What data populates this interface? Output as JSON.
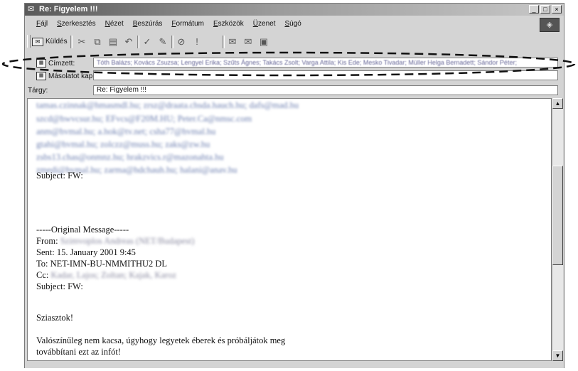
{
  "window": {
    "title": "Re: Figyelem !!!",
    "controls": [
      "_",
      "□",
      "×"
    ]
  },
  "menu": [
    "Fájl",
    "Szerkesztés",
    "Nézet",
    "Beszúrás",
    "Formátum",
    "Eszközök",
    "Üzenet",
    "Súgó"
  ],
  "toolbar": {
    "send_label": "Küldés",
    "icons": [
      "cut-icon",
      "copy-icon",
      "paste-icon",
      "undo-icon",
      "check-names-icon",
      "spelling-icon",
      "attach-icon",
      "priority-icon",
      "sign-icon",
      "encrypt-icon",
      "offline-icon"
    ]
  },
  "headers": {
    "to_label": "Címzett:",
    "to_value": "Tóth Balázs; Kovács Zsuzsa; Lengyel Erika; Szűts Ágnes; Takács Zsolt; Varga Attila; Kis Ede; Mesko Tivadar; Müller Helga Bernadett; Sándor Péter;",
    "cc_label": "Másolatot kap:",
    "cc_value": "",
    "subject_label": "Tárgy:",
    "subject_value": "Re: Figyelem !!!"
  },
  "body": {
    "blurred_lines": [
      "tamas.czinnak@hmasmdl.hu; zrsz@draata.chsda.hauch.hu; dafs@mad.hu",
      "szcd@hwvcsur.hu; EFvcs@F20M.HU; Peter.Ca@nmsc.com",
      "anm@hvmal.hu; a.hok@tv.net; csha77@hvmal.hu",
      "gtahi@hvmal.hu; zolczz@muss.hu; zaks@zw.hu",
      "zsbs13.chas@onmnz.hu; hrakzvics.r@mazonahta.hu",
      "zmedi@hvmal.hu; zarma@hdchauh.hu; halani@anav.hu"
    ],
    "subject1": "Subject: FW:",
    "orig_marker": "-----Original Message-----",
    "from_label": "From:",
    "from_value": "Szimvoplos Andreas (NET/Budapest)",
    "sent": "Sent: 15. January 2001 9:45",
    "to": "To: NET-IMN-BU-NMMITHU2 DL",
    "cc_label": "Cc:",
    "cc_value": "Kadar, Lajos; Zoltan; Kajak, Karoz",
    "subject2": "Subject: FW:",
    "greeting": "Sziasztok!",
    "line1": "Valószínűleg nem kacsa, úgyhogy legyetek éberek és próbáljátok meg",
    "line2": "továbbítani ezt az infót!"
  },
  "colors": {
    "titlebar_dark": "#5a5a5a",
    "chrome": "#d4d4d4",
    "blurred_link": "#6d7fb0"
  }
}
